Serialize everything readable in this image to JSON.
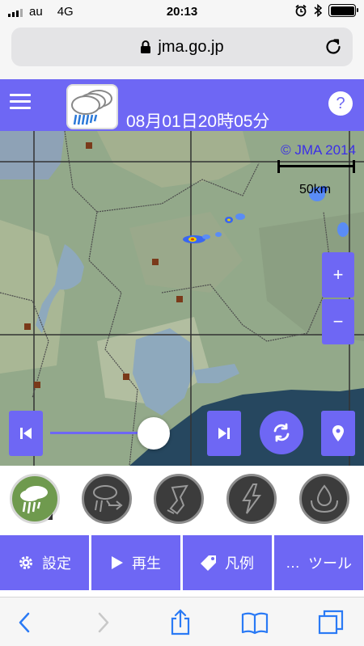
{
  "status": {
    "carrier": "au",
    "network": "4G",
    "time": "20:13",
    "battery_level": 0.95
  },
  "browser": {
    "url": "jma.go.jp"
  },
  "app": {
    "datetime": "08月01日20時05分",
    "help_label": "?"
  },
  "map": {
    "copyright": "© JMA 2014",
    "scale_label": "50km",
    "slider_position": 0.83,
    "colors": {
      "accent": "#6e67f4",
      "land": "#94a98a",
      "water": "#8ea9bd",
      "sea": "#26475f"
    }
  },
  "mode_buttons": [
    {
      "name": "rain-radar-icon",
      "active": true
    },
    {
      "name": "rain-forecast-icon",
      "active": false
    },
    {
      "name": "tornado-icon",
      "active": false
    },
    {
      "name": "lightning-icon",
      "active": false
    },
    {
      "name": "flood-icon",
      "active": false
    }
  ],
  "actions": {
    "settings_label": "設定",
    "play_label": "再生",
    "legend_label": "凡例",
    "tools_label": "ツール",
    "tools_icon_text": "…"
  }
}
